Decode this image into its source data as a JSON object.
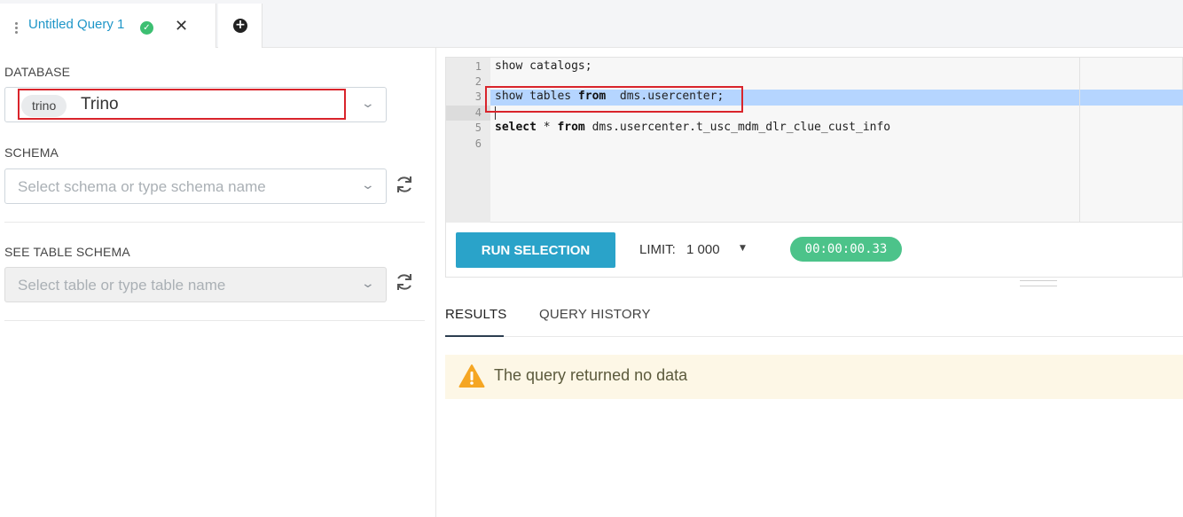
{
  "tabs": {
    "active_title": "Untitled Query 1",
    "close_glyph": "✕",
    "add_glyph": "+",
    "status_glyph": "✓"
  },
  "database": {
    "label": "DATABASE",
    "chip": "trino",
    "value": "Trino"
  },
  "schema": {
    "label": "SCHEMA",
    "placeholder": "Select schema or type schema name"
  },
  "table_schema": {
    "label": "SEE TABLE SCHEMA",
    "placeholder": "Select table or type table name"
  },
  "editor": {
    "line_numbers": [
      "1",
      "2",
      "3",
      "4",
      "5",
      "6"
    ],
    "line1": "show catalogs;",
    "line3_a": "show tables ",
    "line3_kw": "from",
    "line3_b": "  dms.usercenter;",
    "line5_kw1": "select",
    "line5_a": " * ",
    "line5_kw2": "from",
    "line5_b": " dms.usercenter.t_usc_mdm_dlr_clue_cust_info"
  },
  "toolbar": {
    "run_label": "RUN SELECTION",
    "limit_label": "LIMIT:",
    "limit_value": "1 000",
    "timer": "00:00:00.33"
  },
  "results": {
    "tabs": [
      "RESULTS",
      "QUERY HISTORY"
    ],
    "alert_text": "The query returned no data"
  },
  "colors": {
    "accent": "#2aa3c9",
    "tab_title": "#1e96c8",
    "success": "#4cc38a",
    "highlight_box": "#d9242b",
    "warning": "#f5a623"
  }
}
